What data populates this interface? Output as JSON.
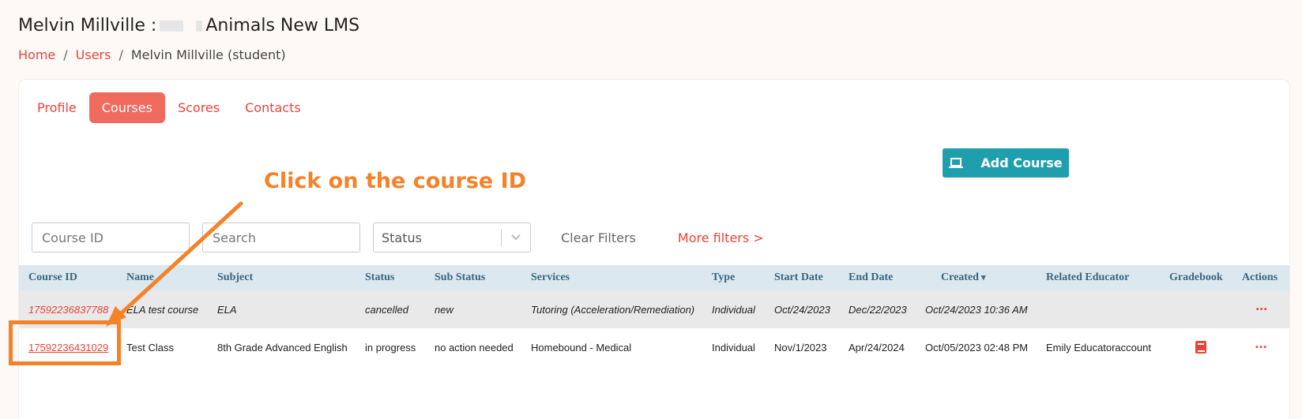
{
  "header": {
    "title_prefix": "Melvin Millville :",
    "title_suffix": "Animals New LMS"
  },
  "breadcrumb": {
    "home": "Home",
    "users": "Users",
    "current": "Melvin Millville (student)",
    "separator": "/"
  },
  "tabs": [
    {
      "label": "Profile",
      "active": false
    },
    {
      "label": "Courses",
      "active": true
    },
    {
      "label": "Scores",
      "active": false
    },
    {
      "label": "Contacts",
      "active": false
    }
  ],
  "actions": {
    "add_course_label": "Add Course",
    "add_course_icon": "laptop-icon"
  },
  "annotation": {
    "callout_text": "Click on the course ID",
    "color": "#f58229"
  },
  "filters": {
    "course_id_placeholder": "Course ID",
    "search_placeholder": "Search",
    "status_value": "Status",
    "clear_label": "Clear Filters",
    "more_label": "More filters >"
  },
  "table": {
    "columns": [
      "Course ID",
      "Name",
      "Subject",
      "Status",
      "Sub Status",
      "Services",
      "Type",
      "Start Date",
      "End Date",
      "Created",
      "Related Educator",
      "Gradebook",
      "Actions"
    ],
    "rows": [
      {
        "course_id": "17592236837788",
        "name": "ELA test course",
        "subject": "ELA",
        "status": "cancelled",
        "sub_status": "new",
        "services": "Tutoring (Acceleration/Remediation)",
        "type": "Individual",
        "start_date": "Oct/24/2023",
        "end_date": "Dec/22/2023",
        "created": "Oct/24/2023 10:36 AM",
        "educator": "",
        "actions": "···"
      },
      {
        "course_id": "17592236431029",
        "name": "Test Class",
        "subject": "8th Grade Advanced English",
        "status": "in progress",
        "sub_status": "no action needed",
        "services": "Homebound - Medical",
        "type": "Individual",
        "start_date": "Nov/1/2023",
        "end_date": "Apr/24/2024",
        "created": "Oct/05/2023 02:48 PM",
        "educator": "Emily Educatoraccount",
        "actions": "···"
      }
    ]
  },
  "colors": {
    "accent": "#e8443a",
    "active_tab": "#f06a5e",
    "primary_button": "#1f9fae",
    "header_row": "#dbe8ef"
  }
}
